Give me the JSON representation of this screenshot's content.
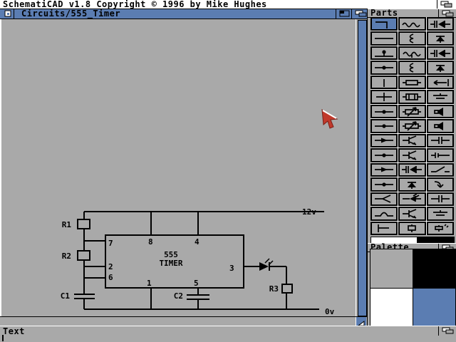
{
  "screen": {
    "title": "SchematiCAD v1.8 Copyright © 1996 by Mike Hughes"
  },
  "document_window": {
    "title": "Circuits/555_Timer"
  },
  "parts_window": {
    "title": "Parts",
    "selected_index": 0,
    "buttons": [
      {
        "name": "wire-corner",
        "icon": "corner"
      },
      {
        "name": "resistor",
        "icon": "wave"
      },
      {
        "name": "diode-capacitor",
        "icon": "capdiode"
      },
      {
        "name": "wire",
        "icon": "line"
      },
      {
        "name": "coil",
        "icon": "squiggle"
      },
      {
        "name": "diode-up",
        "icon": "diodeup"
      },
      {
        "name": "junction-top-dot",
        "icon": "dottop"
      },
      {
        "name": "tapped-coil",
        "icon": "inductortap"
      },
      {
        "name": "diode-capacitor-alt",
        "icon": "capdiode"
      },
      {
        "name": "junction-dot",
        "icon": "dotmid"
      },
      {
        "name": "coil-half",
        "icon": "squiggle"
      },
      {
        "name": "transistor-up",
        "icon": "diodeup"
      },
      {
        "name": "wire-vertical",
        "icon": "vbar"
      },
      {
        "name": "resistor-box",
        "icon": "box"
      },
      {
        "name": "probe-arrow",
        "icon": "arrowcap"
      },
      {
        "name": "wire-cross",
        "icon": "cross"
      },
      {
        "name": "relay",
        "icon": "boxinner"
      },
      {
        "name": "polarized-cap-h",
        "icon": "platesh"
      },
      {
        "name": "junction-bead",
        "icon": "dotmid"
      },
      {
        "name": "potentiometer",
        "icon": "potarrow"
      },
      {
        "name": "speaker",
        "icon": "speaker"
      },
      {
        "name": "junction-dot-large",
        "icon": "dotmid"
      },
      {
        "name": "variable-resistor",
        "icon": "potarrow"
      },
      {
        "name": "buzzer",
        "icon": "speaker"
      },
      {
        "name": "current-source",
        "icon": "arrowmid"
      },
      {
        "name": "transistor-npn",
        "icon": "transistor"
      },
      {
        "name": "capacitor-offset",
        "icon": "plates"
      },
      {
        "name": "junction-arrow",
        "icon": "dotmid"
      },
      {
        "name": "transistor-pnp",
        "icon": "transistor"
      },
      {
        "name": "contact",
        "icon": "contact"
      },
      {
        "name": "arrow-wire",
        "icon": "arrowmid"
      },
      {
        "name": "diode",
        "icon": "capdiode"
      },
      {
        "name": "switch",
        "icon": "switch"
      },
      {
        "name": "junction-node",
        "icon": "dotmid"
      },
      {
        "name": "zener-diode",
        "icon": "diodeup"
      },
      {
        "name": "hook-arrow",
        "icon": "hook"
      },
      {
        "name": "wire-split",
        "icon": "split"
      },
      {
        "name": "led",
        "icon": "led"
      },
      {
        "name": "capacitor",
        "icon": "plates"
      },
      {
        "name": "bump-junction",
        "icon": "bump"
      },
      {
        "name": "phototransistor",
        "icon": "transistor"
      },
      {
        "name": "polarized-capacitor",
        "icon": "platesh"
      },
      {
        "name": "tee-junction",
        "icon": "tee"
      },
      {
        "name": "crystal",
        "icon": "boxsmall"
      },
      {
        "name": "crystal-marked",
        "icon": "boxmarks"
      }
    ]
  },
  "palette_window": {
    "title": "Palette",
    "colors": [
      "#a9a9a9",
      "#000000",
      "#ffffff",
      "#5b7db2"
    ],
    "color_names": [
      "gray",
      "black",
      "white",
      "blue"
    ]
  },
  "text_window": {
    "title": "Text"
  },
  "schematic": {
    "ic": {
      "line1": "555",
      "line2": "TIMER"
    },
    "pins": {
      "p8": "8",
      "p4": "4",
      "p7": "7",
      "p2": "2",
      "p6": "6",
      "p1": "1",
      "p5": "5",
      "p3": "3"
    },
    "components": {
      "r1": "R1",
      "r2": "R2",
      "r3": "R3",
      "c1": "C1",
      "c2": "C2"
    },
    "rails": {
      "vcc": "12v",
      "gnd": "0v"
    }
  },
  "accent_colors": {
    "titlebar_blue": "#5b7db2",
    "workbench_gray": "#a9a9a9",
    "pointer_red": "#c0392b"
  }
}
